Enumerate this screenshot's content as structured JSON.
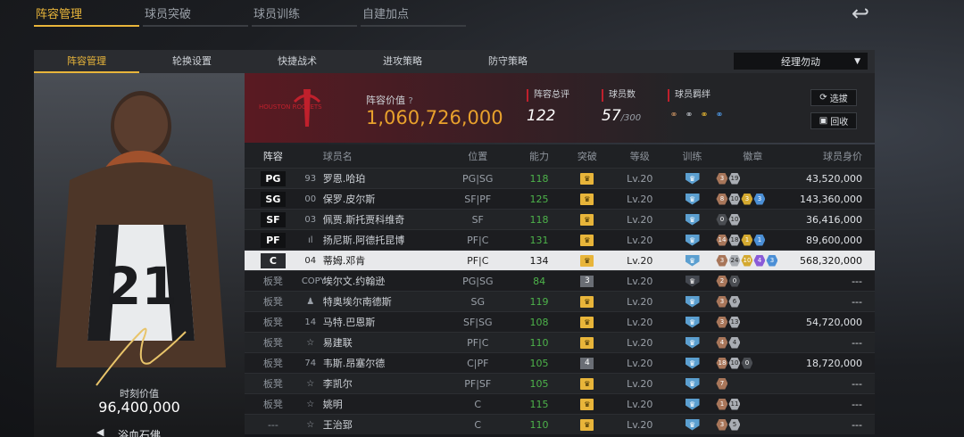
{
  "top_tabs": [
    "阵容管理",
    "球员突破",
    "球员训练",
    "自建加点"
  ],
  "sub_tabs": [
    "阵容管理",
    "轮换设置",
    "快捷战术",
    "进攻策略",
    "防守策略"
  ],
  "manager_select": "经理勿动",
  "card": {
    "jersey_number": "21",
    "value_label": "时刻价值",
    "value": "96,400,000",
    "name": "浴血石佛"
  },
  "team": {
    "logo_text": "HOUSTON ROCKETS",
    "lineup_value_label": "阵容价值",
    "lineup_value": "1,060,726,000",
    "rating_label": "阵容总评",
    "rating": "122",
    "count_label": "球员数",
    "count": "57",
    "count_max": "/300",
    "chem_label": "球员羁绊",
    "select_btn": "选拔",
    "recycle_btn": "回收"
  },
  "columns": [
    "阵容",
    "球员名",
    "位置",
    "能力",
    "突破",
    "等级",
    "训练",
    "徽章",
    "球员身价"
  ],
  "rows": [
    {
      "slot": "PG",
      "starter": true,
      "num": "93",
      "name": "罗恩.哈珀",
      "pos": "PG|SG",
      "ovr": "118",
      "brk": "crown",
      "lvl": "Lv.20",
      "trn": "on",
      "badges": [
        [
          "hb",
          "3"
        ],
        [
          "hs",
          "19"
        ]
      ],
      "sal": "43,520,000"
    },
    {
      "slot": "SG",
      "starter": true,
      "num": "00",
      "name": "保罗.皮尔斯",
      "pos": "SF|PF",
      "ovr": "125",
      "brk": "crown",
      "lvl": "Lv.20",
      "trn": "on",
      "badges": [
        [
          "hb",
          "8"
        ],
        [
          "hs",
          "10"
        ],
        [
          "hg",
          "3"
        ],
        [
          "hu",
          "3"
        ]
      ],
      "sal": "143,360,000"
    },
    {
      "slot": "SF",
      "starter": true,
      "num": "03",
      "name": "佩贾.斯托贾科维奇",
      "pos": "SF",
      "ovr": "118",
      "brk": "crown",
      "lvl": "Lv.20",
      "trn": "on",
      "badges": [
        [
          "hd",
          "0"
        ],
        [
          "hs",
          "10"
        ]
      ],
      "sal": "36,416,000"
    },
    {
      "slot": "PF",
      "starter": true,
      "num": "ıl",
      "name": "扬尼斯.阿德托昆博",
      "pos": "PF|C",
      "ovr": "131",
      "brk": "crown",
      "lvl": "Lv.20",
      "trn": "on",
      "badges": [
        [
          "hb",
          "14"
        ],
        [
          "hs",
          "18"
        ],
        [
          "hg",
          "1"
        ],
        [
          "hu",
          "1"
        ]
      ],
      "sal": "89,600,000"
    },
    {
      "slot": "C",
      "starter": true,
      "sel": true,
      "num": "04",
      "name": "蒂姆.邓肯",
      "pos": "PF|C",
      "ovr": "134",
      "brk": "crown",
      "lvl": "Lv.20",
      "trn": "on",
      "badges": [
        [
          "hb",
          "3"
        ],
        [
          "hs",
          "24"
        ],
        [
          "hg",
          "10"
        ],
        [
          "hp",
          "4"
        ],
        [
          "hu",
          "3"
        ]
      ],
      "sal": "568,320,000"
    },
    {
      "slot": "板凳",
      "starter": false,
      "num": "COPY",
      "name": "埃尔文.约翰逊",
      "pos": "PG|SG",
      "ovr": "84",
      "brk": "3",
      "lvl": "Lv.20",
      "trn": "off",
      "badges": [
        [
          "hb",
          "2"
        ],
        [
          "hd",
          "0"
        ]
      ],
      "sal": "---"
    },
    {
      "slot": "板凳",
      "starter": false,
      "num": "♟",
      "name": "特奥埃尔南德斯",
      "pos": "SG",
      "ovr": "119",
      "brk": "crown",
      "lvl": "Lv.20",
      "trn": "on",
      "badges": [
        [
          "hb",
          "3"
        ],
        [
          "hs",
          "6"
        ]
      ],
      "sal": "---"
    },
    {
      "slot": "板凳",
      "starter": false,
      "num": "14",
      "name": "马特.巴恩斯",
      "pos": "SF|SG",
      "ovr": "108",
      "brk": "crown",
      "lvl": "Lv.20",
      "trn": "on",
      "badges": [
        [
          "hb",
          "3"
        ],
        [
          "hs",
          "13"
        ]
      ],
      "sal": "54,720,000"
    },
    {
      "slot": "板凳",
      "starter": false,
      "num": "☆",
      "name": "易建联",
      "pos": "PF|C",
      "ovr": "110",
      "brk": "crown",
      "lvl": "Lv.20",
      "trn": "on",
      "badges": [
        [
          "hb",
          "4"
        ],
        [
          "hs",
          "4"
        ]
      ],
      "sal": "---"
    },
    {
      "slot": "板凳",
      "starter": false,
      "num": "74",
      "name": "韦斯.昂塞尔德",
      "pos": "C|PF",
      "ovr": "105",
      "brk": "4",
      "lvl": "Lv.20",
      "trn": "on",
      "badges": [
        [
          "hb",
          "18"
        ],
        [
          "hs",
          "10"
        ],
        [
          "hd",
          "0"
        ]
      ],
      "sal": "18,720,000"
    },
    {
      "slot": "板凳",
      "starter": false,
      "num": "☆",
      "name": "李凯尔",
      "pos": "PF|SF",
      "ovr": "105",
      "brk": "crown",
      "lvl": "Lv.20",
      "trn": "on",
      "badges": [
        [
          "hb",
          "7"
        ]
      ],
      "sal": "---"
    },
    {
      "slot": "板凳",
      "starter": false,
      "num": "☆",
      "name": "姚明",
      "pos": "C",
      "ovr": "115",
      "brk": "crown",
      "lvl": "Lv.20",
      "trn": "on",
      "badges": [
        [
          "hb",
          "1"
        ],
        [
          "hs",
          "11"
        ]
      ],
      "sal": "---"
    },
    {
      "slot": "---",
      "starter": false,
      "num": "☆",
      "name": "王治郅",
      "pos": "C",
      "ovr": "110",
      "brk": "crown",
      "lvl": "Lv.20",
      "trn": "on",
      "badges": [
        [
          "hb",
          "3"
        ],
        [
          "hs",
          "5"
        ]
      ],
      "sal": "---"
    }
  ],
  "colors": {
    "accent": "#e8b53a",
    "rockets_red": "#c0202c",
    "ovr_green": "#4db34a"
  }
}
